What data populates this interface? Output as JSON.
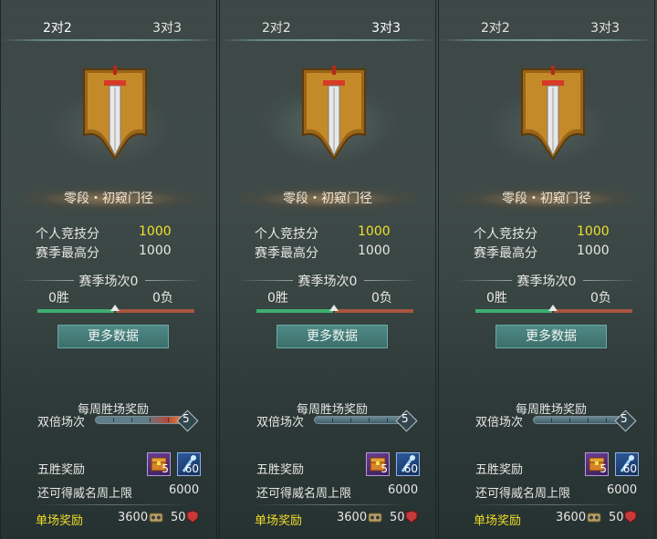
{
  "panels": [
    {
      "tabs": {
        "left": "2对2",
        "right": "3对3",
        "active": "left"
      },
      "rank_name": "零段・初窥门径",
      "personal_score_label": "个人竞技分",
      "personal_score": "1000",
      "season_high_label": "赛季最高分",
      "season_high": "1000",
      "season_matches": "赛季场次0",
      "wins": "0胜",
      "losses": "0负",
      "more_button": "更多数据",
      "weekly_title": "每周胜场奖励",
      "double_label": "双倍场次",
      "double_count": "5",
      "five_win_label": "五胜奖励",
      "item1_count": "5",
      "item2_count": "60",
      "fame_label": "还可得威名周上限",
      "fame_value": "6000",
      "single_label": "单场奖励",
      "single_value1": "3600",
      "single_value2": "50"
    },
    {
      "tabs": {
        "left": "2对2",
        "right": "3对3",
        "active": "right"
      },
      "rank_name": "零段・初窥门径",
      "personal_score_label": "个人竞技分",
      "personal_score": "1000",
      "season_high_label": "赛季最高分",
      "season_high": "1000",
      "season_matches": "赛季场次0",
      "wins": "0胜",
      "losses": "0负",
      "more_button": "更多数据",
      "weekly_title": "每周胜场奖励",
      "double_label": "双倍场次",
      "double_count": "5",
      "five_win_label": "五胜奖励",
      "item1_count": "5",
      "item2_count": "60",
      "fame_label": "还可得威名周上限",
      "fame_value": "6000",
      "single_label": "单场奖励",
      "single_value1": "3600",
      "single_value2": "50"
    },
    {
      "tabs": {
        "left": "2对2",
        "right": "3对3",
        "active": "none"
      },
      "rank_name": "零段・初窥门径",
      "personal_score_label": "个人竞技分",
      "personal_score": "1000",
      "season_high_label": "赛季最高分",
      "season_high": "1000",
      "season_matches": "赛季场次0",
      "wins": "0胜",
      "losses": "0负",
      "more_button": "更多数据",
      "weekly_title": "每周胜场奖励",
      "double_label": "双倍场次",
      "double_count": "5",
      "five_win_label": "五胜奖励",
      "item1_count": "5",
      "item2_count": "60",
      "fame_label": "还可得威名周上限",
      "fame_value": "6000",
      "single_label": "单场奖励",
      "single_value1": "3600",
      "single_value2": "50"
    }
  ],
  "icons": {
    "emblem": "sword-banner-icon",
    "item1": "treasure-chest-icon",
    "item2": "wand-icon",
    "coin": "coin-icon",
    "badge": "demon-badge-icon"
  },
  "colors": {
    "score_highlight": "#f0e02a",
    "single_reward_label": "#f0dc2a",
    "win_bar": "#3fae6e",
    "loss_bar": "#a7553f"
  }
}
